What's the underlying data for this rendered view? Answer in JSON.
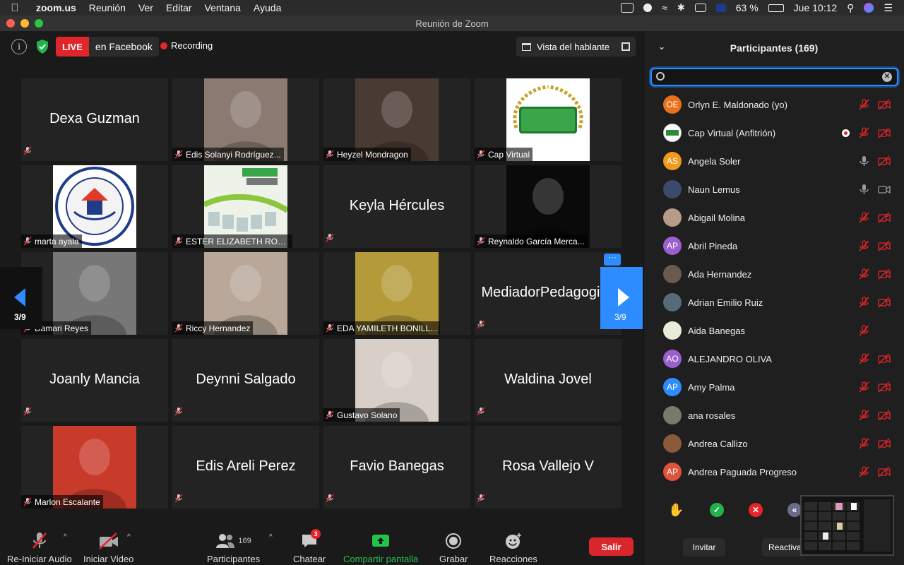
{
  "menubar": {
    "app": "zoom.us",
    "menus": [
      "Reunión",
      "Ver",
      "Editar",
      "Ventana",
      "Ayuda"
    ],
    "battery": "63 %",
    "clock": "Jue 10:12"
  },
  "window": {
    "title": "Reunión de Zoom"
  },
  "topbar": {
    "info_icon_label": "i",
    "live_label": "LIVE",
    "live_target": "en Facebook",
    "recording_label": "Recording",
    "view_label": "Vista del hablante"
  },
  "tiles": [
    {
      "name": "Dexa Guzman",
      "label": "",
      "type": "name",
      "photo_color": ""
    },
    {
      "name": "",
      "label": "Edis Solanyi Rodríguez...",
      "type": "photo",
      "photo_color": "#8a7a72"
    },
    {
      "name": "",
      "label": "Heyzel Mondragon",
      "type": "photo",
      "photo_color": "#4a3a34"
    },
    {
      "name": "",
      "label": "Cap Virtual",
      "type": "logo-uth",
      "photo_color": "#ffffff"
    },
    {
      "name": "",
      "label": "marta ayala",
      "type": "logo-seal",
      "photo_color": "#ffffff"
    },
    {
      "name": "",
      "label": "ESTER ELIZABETH ROD...",
      "type": "logo-cap",
      "photo_color": "#e8f0e4"
    },
    {
      "name": "Keyla Hércules",
      "label": "",
      "type": "name",
      "photo_color": ""
    },
    {
      "name": "",
      "label": "Reynaldo García Merca...",
      "type": "photo",
      "photo_color": "#0a0a0a"
    },
    {
      "name": "",
      "label": "Damari Reyes",
      "type": "photo",
      "photo_color": "#777777"
    },
    {
      "name": "",
      "label": "Riccy Hernandez",
      "type": "photo",
      "photo_color": "#b9a89a"
    },
    {
      "name": "",
      "label": "EDA YAMILETH BONILL...",
      "type": "photo",
      "photo_color": "#b59a3a"
    },
    {
      "name": "MediadorPedagogico",
      "label": "",
      "type": "name",
      "photo_color": ""
    },
    {
      "name": "Joanly Mancia",
      "label": "",
      "type": "name",
      "photo_color": ""
    },
    {
      "name": "Deynni Salgado",
      "label": "",
      "type": "name",
      "photo_color": ""
    },
    {
      "name": "",
      "label": "Gustavo Solano",
      "type": "photo",
      "photo_color": "#d8d0c8"
    },
    {
      "name": "Waldina Jovel",
      "label": "",
      "type": "name",
      "photo_color": ""
    },
    {
      "name": "",
      "label": "Marlon Escalante",
      "type": "photo",
      "photo_color": "#c83a2a"
    },
    {
      "name": "Edis Areli Perez",
      "label": "",
      "type": "name",
      "photo_color": ""
    },
    {
      "name": "Favio Banegas",
      "label": "",
      "type": "name",
      "photo_color": ""
    },
    {
      "name": "Rosa Vallejo V",
      "label": "",
      "type": "name",
      "photo_color": ""
    }
  ],
  "pager": {
    "left": "3/9",
    "right": "3/9",
    "more": "···"
  },
  "toolbar": {
    "audio": "Re-Iniciar Audio",
    "video": "Iniciar Video",
    "participants": "Participantes",
    "participant_count": "169",
    "chat": "Chatear",
    "chat_badge": "3",
    "share": "Compartir pantalla",
    "record": "Grabar",
    "reactions": "Reacciones",
    "leave": "Salir"
  },
  "panel": {
    "title": "Participantes (169)",
    "search_placeholder": "",
    "participants": [
      {
        "name": "Orlyn E. Maldonado (yo)",
        "initials": "OE",
        "color": "#e8711a",
        "mic": "off",
        "video": "off",
        "rec": false
      },
      {
        "name": "Cap Virtual (Anfitrión)",
        "initials": "",
        "color": "#ffffff",
        "mic": "off",
        "video": "off",
        "rec": true
      },
      {
        "name": "Angela Soler",
        "initials": "AS",
        "color": "#f29a1d",
        "mic": "on",
        "video": "off",
        "rec": false
      },
      {
        "name": "Naun Lemus",
        "initials": "",
        "color": "#3a4a6a",
        "mic": "on",
        "video": "on",
        "rec": false
      },
      {
        "name": "Abigail Molina",
        "initials": "",
        "color": "#b89a88",
        "mic": "off",
        "video": "off",
        "rec": false
      },
      {
        "name": "Abril Pineda",
        "initials": "AP",
        "color": "#9b5fd0",
        "mic": "off",
        "video": "off",
        "rec": false
      },
      {
        "name": "Ada Hernandez",
        "initials": "",
        "color": "#6a5a50",
        "mic": "off",
        "video": "off",
        "rec": false
      },
      {
        "name": "Adrian Emilio Ruiz",
        "initials": "",
        "color": "#556b7a",
        "mic": "off",
        "video": "off",
        "rec": false
      },
      {
        "name": "Aida Banegas",
        "initials": "",
        "color": "#e8ecd8",
        "mic": "off",
        "video": "none",
        "rec": false
      },
      {
        "name": "ALEJANDRO OLIVA",
        "initials": "AO",
        "color": "#9b5fd0",
        "mic": "off",
        "video": "off",
        "rec": false
      },
      {
        "name": "Amy Palma",
        "initials": "AP",
        "color": "#2d8cff",
        "mic": "off",
        "video": "off",
        "rec": false
      },
      {
        "name": "ana rosales",
        "initials": "",
        "color": "#7a7a6a",
        "mic": "off",
        "video": "off",
        "rec": false
      },
      {
        "name": "Andrea Callizo",
        "initials": "",
        "color": "#8a5a3a",
        "mic": "off",
        "video": "off",
        "rec": false
      },
      {
        "name": "Andrea Paguada Progreso",
        "initials": "AP",
        "color": "#e0533a",
        "mic": "off",
        "video": "off",
        "rec": false
      }
    ],
    "invite": "Invitar",
    "reactivate": "Reactiva"
  }
}
